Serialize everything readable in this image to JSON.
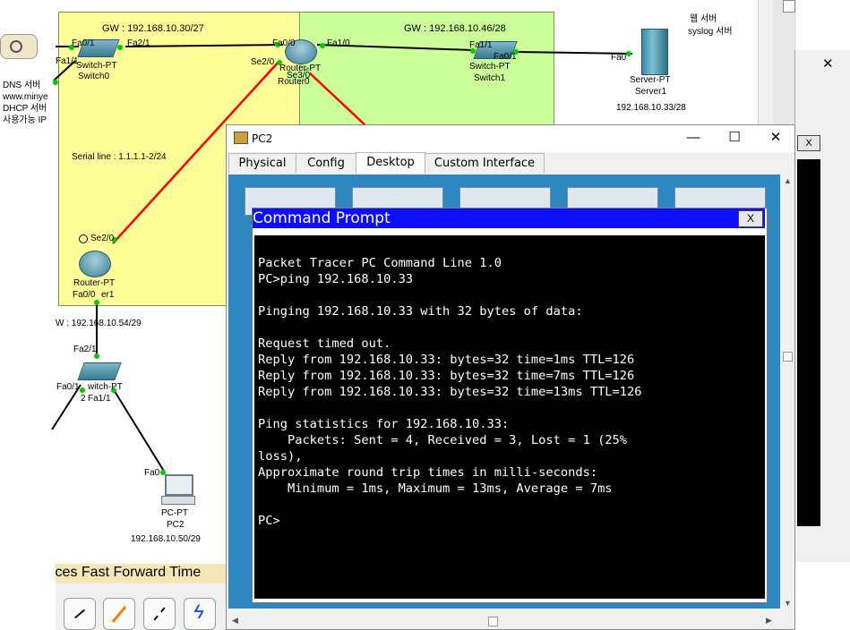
{
  "topology": {
    "gw_left": "GW : 192.168.10.30/27",
    "gw_right": "GW : 192.168.10.46/28",
    "gw_bottom": "W : 192.168.10.54/29",
    "serial_line": "Serial line : 1.1.1.1-2/24",
    "left_info": [
      "DNS 서버",
      "www.minye",
      "DHCP 서버",
      "사용가능 IP"
    ],
    "server_note": [
      "웹 서버",
      "syslog 서버"
    ],
    "switch0": {
      "type": "Switch-PT",
      "name": "Switch0",
      "ports": {
        "left": "Fa0/1",
        "right": "Fa2/1",
        "bottom": "Fa1/1"
      }
    },
    "router0": {
      "type": "Router-PT",
      "name": "Router0",
      "ports": {
        "left": "Fa0/0",
        "right": "Fa1/0",
        "se2": "Se2/0",
        "se3": "Se3/0"
      }
    },
    "switch1": {
      "type": "Switch-PT",
      "name": "Switch1",
      "ports": {
        "left": "Fa1/1",
        "right": "Fa0/1"
      }
    },
    "server1": {
      "type": "Server-PT",
      "name": "Server1",
      "port": "Fa0",
      "ip": "192.168.10.33/28"
    },
    "router1": {
      "type": "Router-PT",
      "name": "er1",
      "ports": {
        "se": "Se2/0",
        "fa": "Fa0/0"
      }
    },
    "switch2": {
      "type": "witch-PT",
      "ports": {
        "top": "Fa2/1",
        "left": "Fa0/1",
        "right": "Fa1/1"
      },
      "name_fragment": "2"
    },
    "pc2": {
      "type": "PC-PT",
      "name": "PC2",
      "port": "Fa0",
      "ip": "192.168.10.50/29"
    }
  },
  "pc_window": {
    "title": "PC2",
    "controls": {
      "minimize": "—",
      "maximize": "☐",
      "close": "✕"
    },
    "tabs": [
      "Physical",
      "Config",
      "Desktop",
      "Custom Interface"
    ],
    "active_tab": "Desktop",
    "command_prompt": {
      "title": "Command Prompt",
      "close_label": "X",
      "output": "Packet Tracer PC Command Line 1.0\nPC>ping 192.168.10.33\n\nPinging 192.168.10.33 with 32 bytes of data:\n\nRequest timed out.\nReply from 192.168.10.33: bytes=32 time=1ms TTL=126\nReply from 192.168.10.33: bytes=32 time=7ms TTL=126\nReply from 192.168.10.33: bytes=32 time=13ms TTL=126\n\nPing statistics for 192.168.10.33:\n    Packets: Sent = 4, Received = 3, Lost = 1 (25%\nloss),\nApproximate round trip times in milli-seconds:\n    Minimum = 1ms, Maximum = 13ms, Average = 7ms\n\nPC>"
    }
  },
  "background_window": {
    "close_label": "✕",
    "inner_close_label": "X"
  },
  "bottom_toolbar": {
    "speed_label": "ices Fast Forward Time"
  },
  "colors": {
    "zone_yellow": "#ffff99",
    "zone_green": "#ccff99",
    "serial_link": "#ff0000",
    "cmd_title": "#0f0fff",
    "desktop_bg": "#2e86c1"
  }
}
